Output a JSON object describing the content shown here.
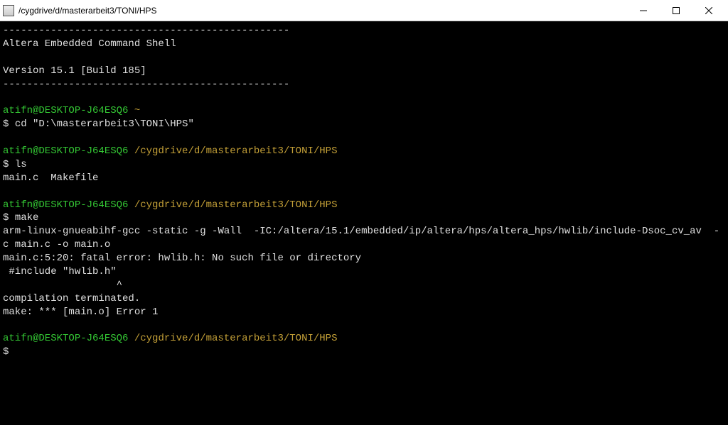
{
  "window": {
    "title": "/cygdrive/d/masterarbeit3/TONI/HPS"
  },
  "term": {
    "sep": "------------------------------------------------",
    "banner1": "Altera Embedded Command Shell",
    "banner2": "Version 15.1 [Build 185]",
    "userhost": "atifn@DESKTOP-J64ESQ6",
    "home_path": " ~",
    "cwd_path": " /cygdrive/d/masterarbeit3/TONI/HPS",
    "prompt": "$ ",
    "cmd_cd": "cd \"D:\\masterarbeit3\\TONI\\HPS\"",
    "cmd_ls": "ls",
    "ls_out": "main.c  Makefile",
    "cmd_make": "make",
    "make_line1": "arm-linux-gnueabihf-gcc -static -g -Wall  -IC:/altera/15.1/embedded/ip/altera/hps/altera_hps/hwlib/include-Dsoc_cv_av  -",
    "make_line2": "c main.c -o main.o",
    "err_line1": "main.c:5:20: fatal error: hwlib.h: No such file or directory",
    "err_line2": " #include \"hwlib.h\"",
    "err_caret": "                   ^",
    "err_line3": "compilation terminated.",
    "err_line4": "make: *** [main.o] Error 1"
  }
}
